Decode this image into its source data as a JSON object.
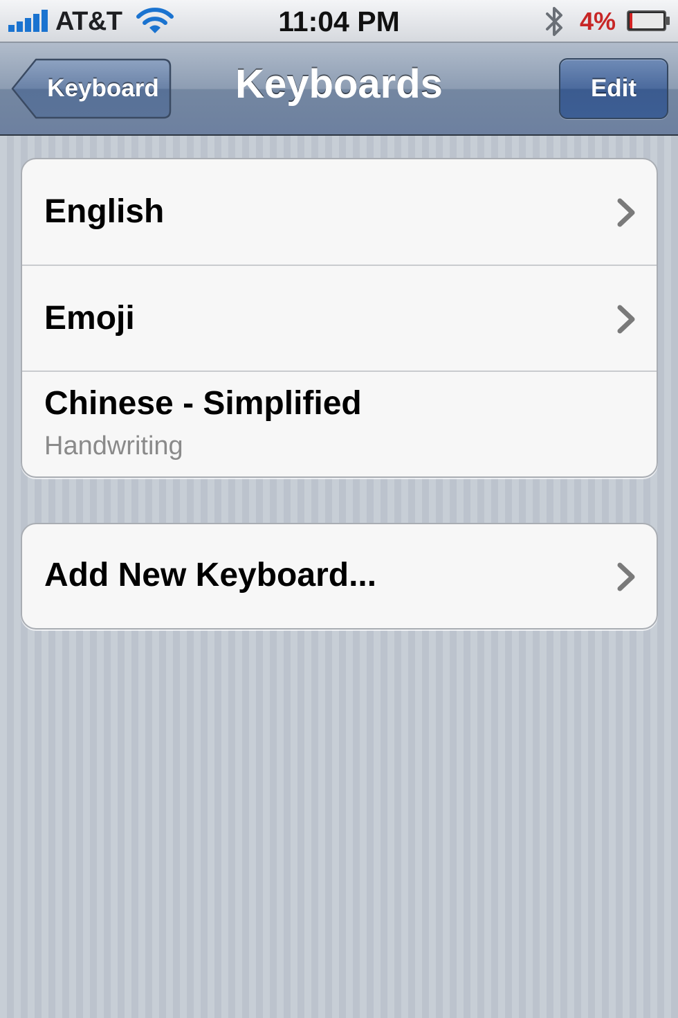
{
  "status_bar": {
    "carrier": "AT&T",
    "time": "11:04 PM",
    "battery_percent": "4%",
    "icons": [
      "signal-bars-icon",
      "wifi-icon",
      "bluetooth-icon",
      "battery-icon"
    ],
    "battery_color": "#c72626"
  },
  "nav": {
    "back_label": "Keyboard",
    "title": "Keyboards",
    "edit_label": "Edit"
  },
  "keyboards": [
    {
      "label": "English",
      "detail": "",
      "has_chevron": true
    },
    {
      "label": "Emoji",
      "detail": "",
      "has_chevron": true
    },
    {
      "label": "Chinese - Simplified",
      "detail": "Handwriting",
      "has_chevron": false
    }
  ],
  "add_keyboard": {
    "label": "Add New Keyboard...",
    "has_chevron": true
  }
}
